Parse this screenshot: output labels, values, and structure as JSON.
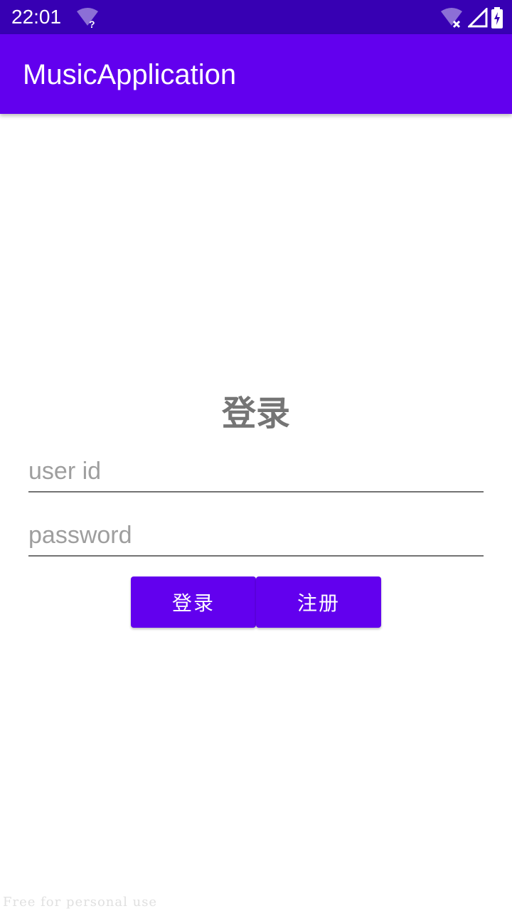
{
  "status_bar": {
    "time": "22:01",
    "icons": [
      "wifi-question-icon",
      "wifi-off-icon",
      "signal-icon",
      "battery-charging-icon"
    ],
    "background": "#3700b3"
  },
  "app_bar": {
    "title": "MusicApplication",
    "background": "#6200ee"
  },
  "login_form": {
    "heading": "登录",
    "user_id_placeholder": "user id",
    "password_placeholder": "password",
    "login_button": "登录",
    "register_button": "注册",
    "button_color": "#6200ee"
  },
  "watermark": "Free for personal use"
}
